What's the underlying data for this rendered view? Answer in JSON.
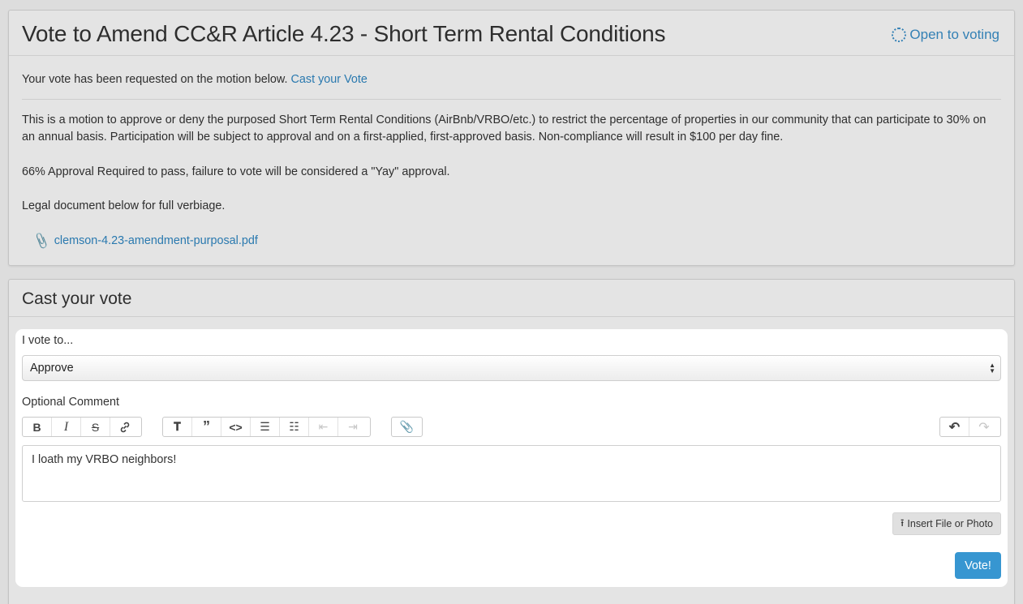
{
  "motion": {
    "title": "Vote to Amend CC&R Article 4.23 - Short Term Rental Conditions",
    "status": "Open to voting",
    "requested_text": "Your vote has been requested on the motion below.",
    "cast_link": "Cast your Vote",
    "description": "This is a motion to approve or deny the purposed Short Term Rental Conditions (AirBnb/VRBO/etc.) to restrict the percentage of properties in our community that can participate to 30% on an annual basis. Participation will be subject to approval and on a first-applied, first-approved basis. Non-compliance will result in $100 per day fine.",
    "approval_note": "66% Approval Required to pass, failure to vote will be considered a \"Yay\" approval.",
    "legal_note": "Legal document below for full verbiage.",
    "attachment": "clemson-4.23-amendment-purposal.pdf"
  },
  "vote_panel": {
    "title": "Cast your vote",
    "vote_label": "I vote to...",
    "selected_option": "Approve",
    "comment_label": "Optional Comment",
    "comment_value": "I loath my VRBO neighbors!",
    "insert_button": "Insert File or Photo",
    "submit_button": "Vote!"
  },
  "toolbar": {
    "icons": [
      "bold-icon",
      "italic-icon",
      "strikethrough-icon",
      "link-icon",
      "heading-icon",
      "quote-icon",
      "code-icon",
      "bullet-list-icon",
      "numbered-list-icon",
      "decrease-indent-icon",
      "increase-indent-icon",
      "attach-icon",
      "undo-icon",
      "redo-icon"
    ]
  },
  "colors": {
    "accent": "#3796d1",
    "link": "#2f86c1"
  }
}
